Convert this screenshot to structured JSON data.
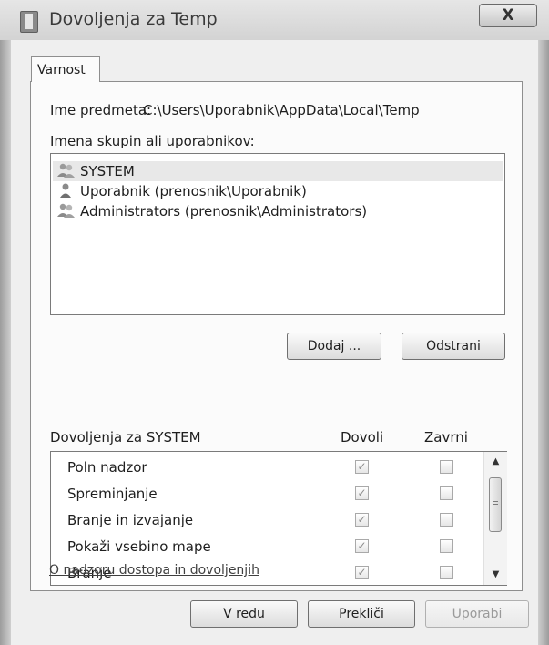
{
  "window": {
    "title": "Dovoljenja za Temp",
    "close_label": "X"
  },
  "tabs": [
    {
      "label": "Varnost",
      "active": true
    }
  ],
  "object": {
    "label": "Ime predmeta:",
    "value": "C:\\Users\\Uporabnik\\AppData\\Local\\Temp"
  },
  "groups": {
    "label": "Imena skupin ali uporabnikov:",
    "items": [
      {
        "name": "SYSTEM",
        "icon": "group-icon",
        "selected": true
      },
      {
        "name": "Uporabnik (prenosnik\\Uporabnik)",
        "icon": "user-icon",
        "selected": false
      },
      {
        "name": "Administrators (prenosnik\\Administrators)",
        "icon": "group-icon",
        "selected": false
      }
    ],
    "add_label": "Dodaj ...",
    "remove_label": "Odstrani"
  },
  "permissions": {
    "header": "Dovoljenja za SYSTEM",
    "allow_header": "Dovoli",
    "deny_header": "Zavrni",
    "rows": [
      {
        "name": "Poln nadzor",
        "allow": true,
        "deny": false
      },
      {
        "name": "Spreminjanje",
        "allow": true,
        "deny": false
      },
      {
        "name": "Branje in izvajanje",
        "allow": true,
        "deny": false
      },
      {
        "name": "Pokaži vsebino mape",
        "allow": true,
        "deny": false
      },
      {
        "name": "Branje",
        "allow": true,
        "deny": false
      }
    ]
  },
  "help_link": "O nadzoru dostopa in dovoljenjih",
  "footer": {
    "ok_label": "V redu",
    "cancel_label": "Prekliči",
    "apply_label": "Uporabi"
  }
}
